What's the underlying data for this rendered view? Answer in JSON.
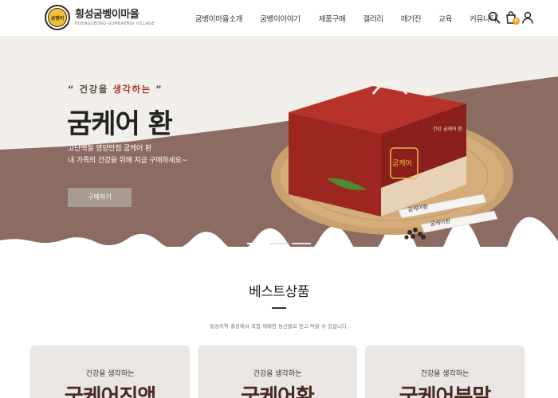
{
  "header": {
    "logo_name": "횡성굼벵이마을",
    "logo_en": "HOENGSEONG GUMBAENGI VILLAGE",
    "logo_badge": "굼벵이",
    "nav": [
      "굼벵이마을소개",
      "굼벵이이야기",
      "제품구매",
      "갤러리",
      "매거진",
      "교육",
      "커뮤니티"
    ],
    "icons": [
      "search-icon",
      "cart-icon",
      "user-icon"
    ],
    "cart_count": "0"
  },
  "hero": {
    "sub_open": "“ 건강을 ",
    "sub_accent": "생각하는",
    "sub_close": " ”",
    "title": "굼케어 환",
    "desc_line1": "고단백질 영양만점 굼케어 환",
    "desc_line2": "내 가족의 건강을 위해 지금 구매하세요~",
    "button": "구매하기",
    "box_label": "굼케어",
    "box_side": "건강 굼케어 환",
    "stick1": "굼케어환",
    "stick2": "굼케어환",
    "slides": 3,
    "active_slide": 1
  },
  "best": {
    "title": "베스트상품",
    "desc": "횡성지역 횡성에서 직접 재배한 농산물로 믿고 먹을 수 있습니다.",
    "cards": [
      {
        "sub": "건강을 생각하는",
        "title": "굼케어진액"
      },
      {
        "sub": "건강을 생각하는",
        "title": "굼케어환"
      },
      {
        "sub": "건강을 생각하는",
        "title": "굼케어분말"
      }
    ]
  },
  "colors": {
    "brown": "#8b6a60",
    "accent_red": "#a53a2e",
    "button": "#a89a91",
    "cart_badge": "#f39a1d"
  }
}
